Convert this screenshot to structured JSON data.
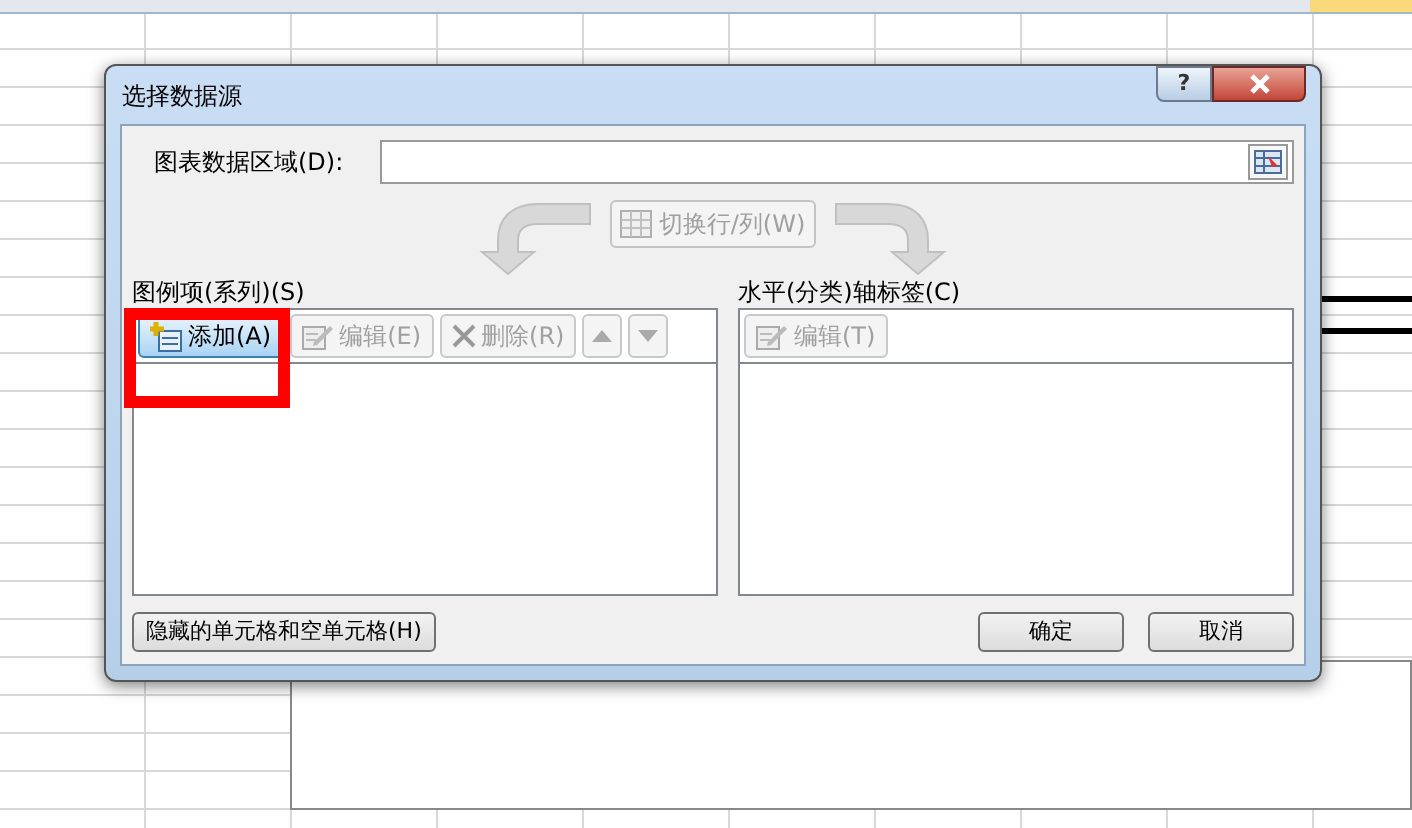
{
  "dialog": {
    "title": "选择数据源",
    "help": "?",
    "range": {
      "label": "图表数据区域(D):"
    },
    "switch_button": {
      "label": "切换行/列(W)",
      "disabled": true
    },
    "series": {
      "label": "图例项(系列)(S)",
      "buttons": [
        {
          "kind": "add",
          "label": "添加(A)",
          "disabled": false,
          "highlighted": true
        },
        {
          "kind": "edit",
          "label": "编辑(E)",
          "disabled": true,
          "highlighted": false
        },
        {
          "kind": "delete",
          "label": "删除(R)",
          "disabled": true,
          "highlighted": false
        },
        {
          "kind": "up",
          "disabled": true,
          "highlighted": false
        },
        {
          "kind": "down",
          "disabled": true,
          "highlighted": false
        }
      ]
    },
    "categories": {
      "label": "水平(分类)轴标签(C)",
      "buttons": [
        {
          "kind": "edit",
          "label": "编辑(T)",
          "disabled": true,
          "highlighted": false
        }
      ]
    },
    "hidden_cells_button": "隐藏的单元格和空单元格(H)",
    "ok": "确定",
    "cancel": "取消"
  }
}
